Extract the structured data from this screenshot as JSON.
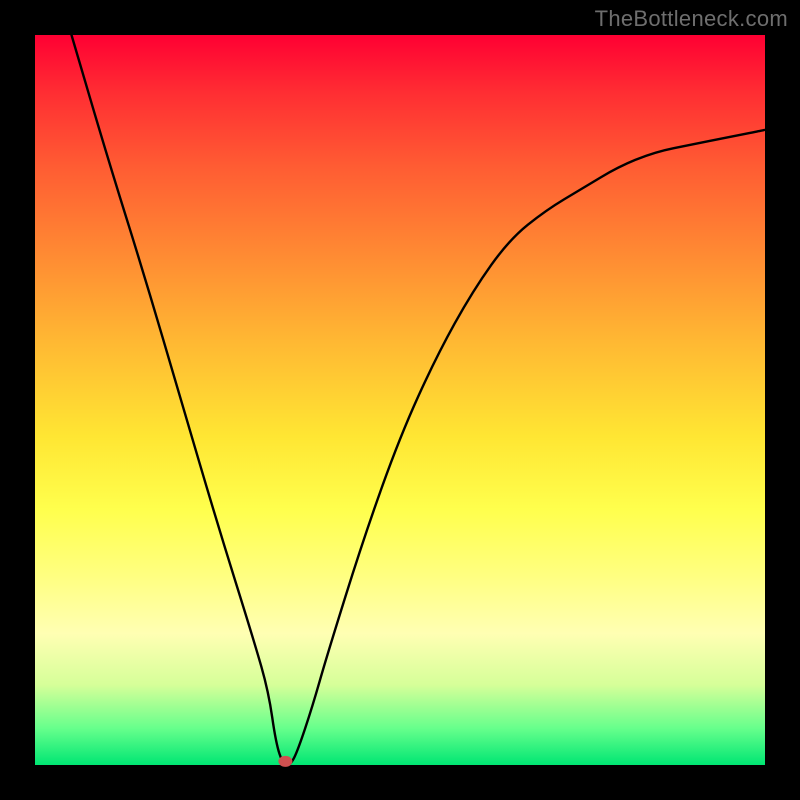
{
  "watermark": "TheBottleneck.com",
  "chart_data": {
    "type": "line",
    "title": "",
    "xlabel": "",
    "ylabel": "",
    "xlim": [
      0,
      100
    ],
    "ylim": [
      0,
      100
    ],
    "series": [
      {
        "name": "bottleneck-curve",
        "x": [
          5,
          10,
          15,
          20,
          25,
          30,
          32,
          33,
          34,
          35,
          36,
          38,
          40,
          45,
          50,
          55,
          60,
          65,
          70,
          75,
          80,
          85,
          90,
          95,
          100
        ],
        "values": [
          100,
          83,
          67,
          50,
          33,
          17,
          10,
          3,
          0,
          0,
          2,
          8,
          15,
          31,
          45,
          56,
          65,
          72,
          76,
          79,
          82,
          84,
          85,
          86,
          87
        ]
      }
    ],
    "annotations": [
      {
        "type": "marker",
        "shape": "ellipse",
        "x": 34.3,
        "y": 0.5,
        "color": "#d05050"
      }
    ],
    "gradient_bands": [
      {
        "position": 0.0,
        "color": "#ff0033"
      },
      {
        "position": 0.08,
        "color": "#ff2e33"
      },
      {
        "position": 0.18,
        "color": "#ff5c33"
      },
      {
        "position": 0.3,
        "color": "#ff8a33"
      },
      {
        "position": 0.42,
        "color": "#ffb833"
      },
      {
        "position": 0.55,
        "color": "#ffe633"
      },
      {
        "position": 0.65,
        "color": "#ffff4d"
      },
      {
        "position": 0.74,
        "color": "#ffff80"
      },
      {
        "position": 0.82,
        "color": "#ffffb3"
      },
      {
        "position": 0.89,
        "color": "#d6ff99"
      },
      {
        "position": 0.95,
        "color": "#66ff8c"
      },
      {
        "position": 1.0,
        "color": "#00e673"
      }
    ]
  }
}
